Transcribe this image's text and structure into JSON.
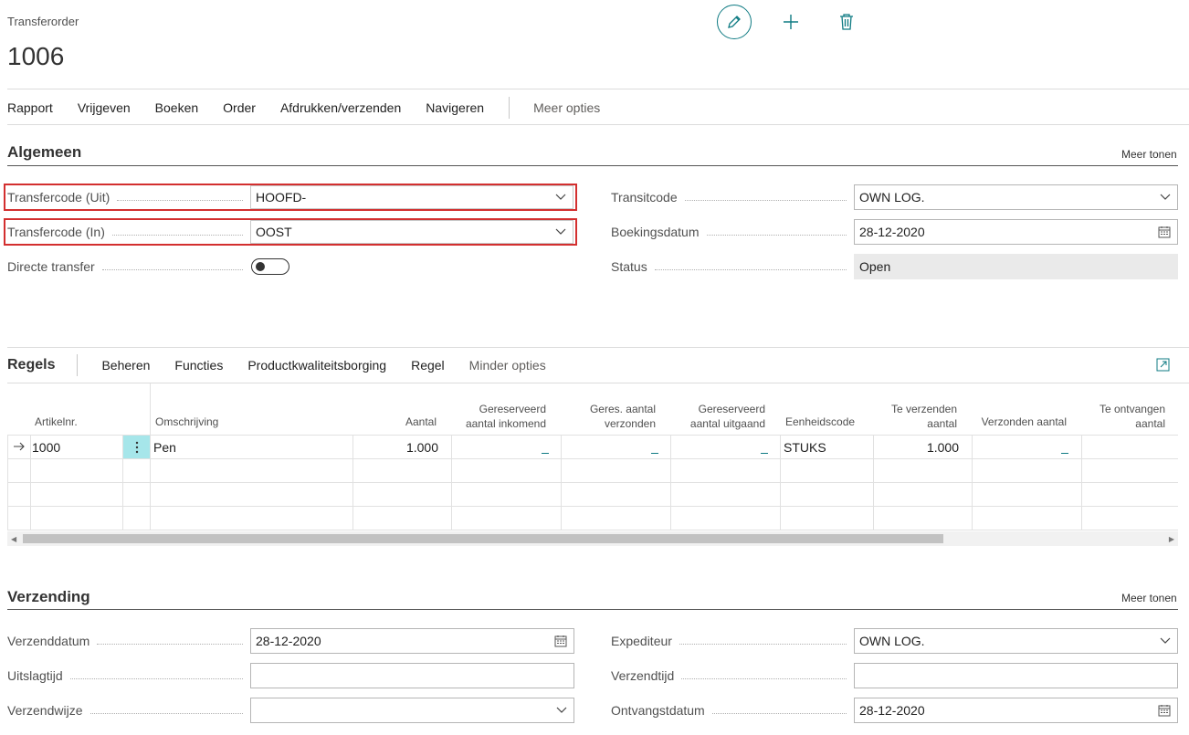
{
  "header": {
    "caption": "Transferorder",
    "record_no": "1006"
  },
  "top_actions": {
    "edit_icon": "pencil-icon",
    "add_icon": "plus-icon",
    "delete_icon": "trash-icon",
    "accent": "#0f7b83"
  },
  "action_bar": {
    "items": [
      "Rapport",
      "Vrijgeven",
      "Boeken",
      "Order",
      "Afdrukken/verzenden",
      "Navigeren"
    ],
    "more": "Meer opties"
  },
  "algemeen": {
    "title": "Algemeen",
    "show_more": "Meer tonen",
    "transfer_from_label": "Transfercode (Uit)",
    "transfer_from_value": "HOOFD-",
    "transfer_to_label": "Transfercode (In)",
    "transfer_to_value": "OOST",
    "direct_transfer_label": "Directe transfer",
    "direct_transfer_on": false,
    "transit_label": "Transitcode",
    "transit_value": "OWN LOG.",
    "posting_date_label": "Boekingsdatum",
    "posting_date_value": "28-12-2020",
    "status_label": "Status",
    "status_value": "Open"
  },
  "lines": {
    "title": "Regels",
    "actions": [
      "Beheren",
      "Functies",
      "Productkwaliteitsborging",
      "Regel"
    ],
    "less": "Minder opties",
    "expand_icon": "expand-icon",
    "columns": {
      "item_no": "Artikelnr.",
      "description": "Omschrijving",
      "quantity": "Aantal",
      "reserved_in_1": "Gereserveerd",
      "reserved_in_2": "aantal inkomend",
      "reserved_ship_1": "Geres. aantal",
      "reserved_ship_2": "verzonden",
      "reserved_out_1": "Gereserveerd",
      "reserved_out_2": "aantal uitgaand",
      "uom": "Eenheidscode",
      "to_ship_1": "Te verzenden",
      "to_ship_2": "aantal",
      "shipped": "Verzonden aantal",
      "to_receive_1": "Te ontvangen",
      "to_receive_2": "aantal"
    },
    "row": {
      "item_no": "1000",
      "description": "Pen",
      "quantity": "1.000",
      "uom": "STUKS",
      "to_ship": "1.000"
    }
  },
  "verzending": {
    "title": "Verzending",
    "show_more": "Meer tonen",
    "ship_date_label": "Verzenddatum",
    "ship_date_value": "28-12-2020",
    "outbound_time_label": "Uitslagtijd",
    "outbound_time_value": "",
    "ship_method_label": "Verzendwijze",
    "ship_method_value": "",
    "carrier_label": "Expediteur",
    "carrier_value": "OWN LOG.",
    "ship_time_label": "Verzendtijd",
    "ship_time_value": "",
    "receipt_date_label": "Ontvangstdatum",
    "receipt_date_value": "28-12-2020"
  }
}
